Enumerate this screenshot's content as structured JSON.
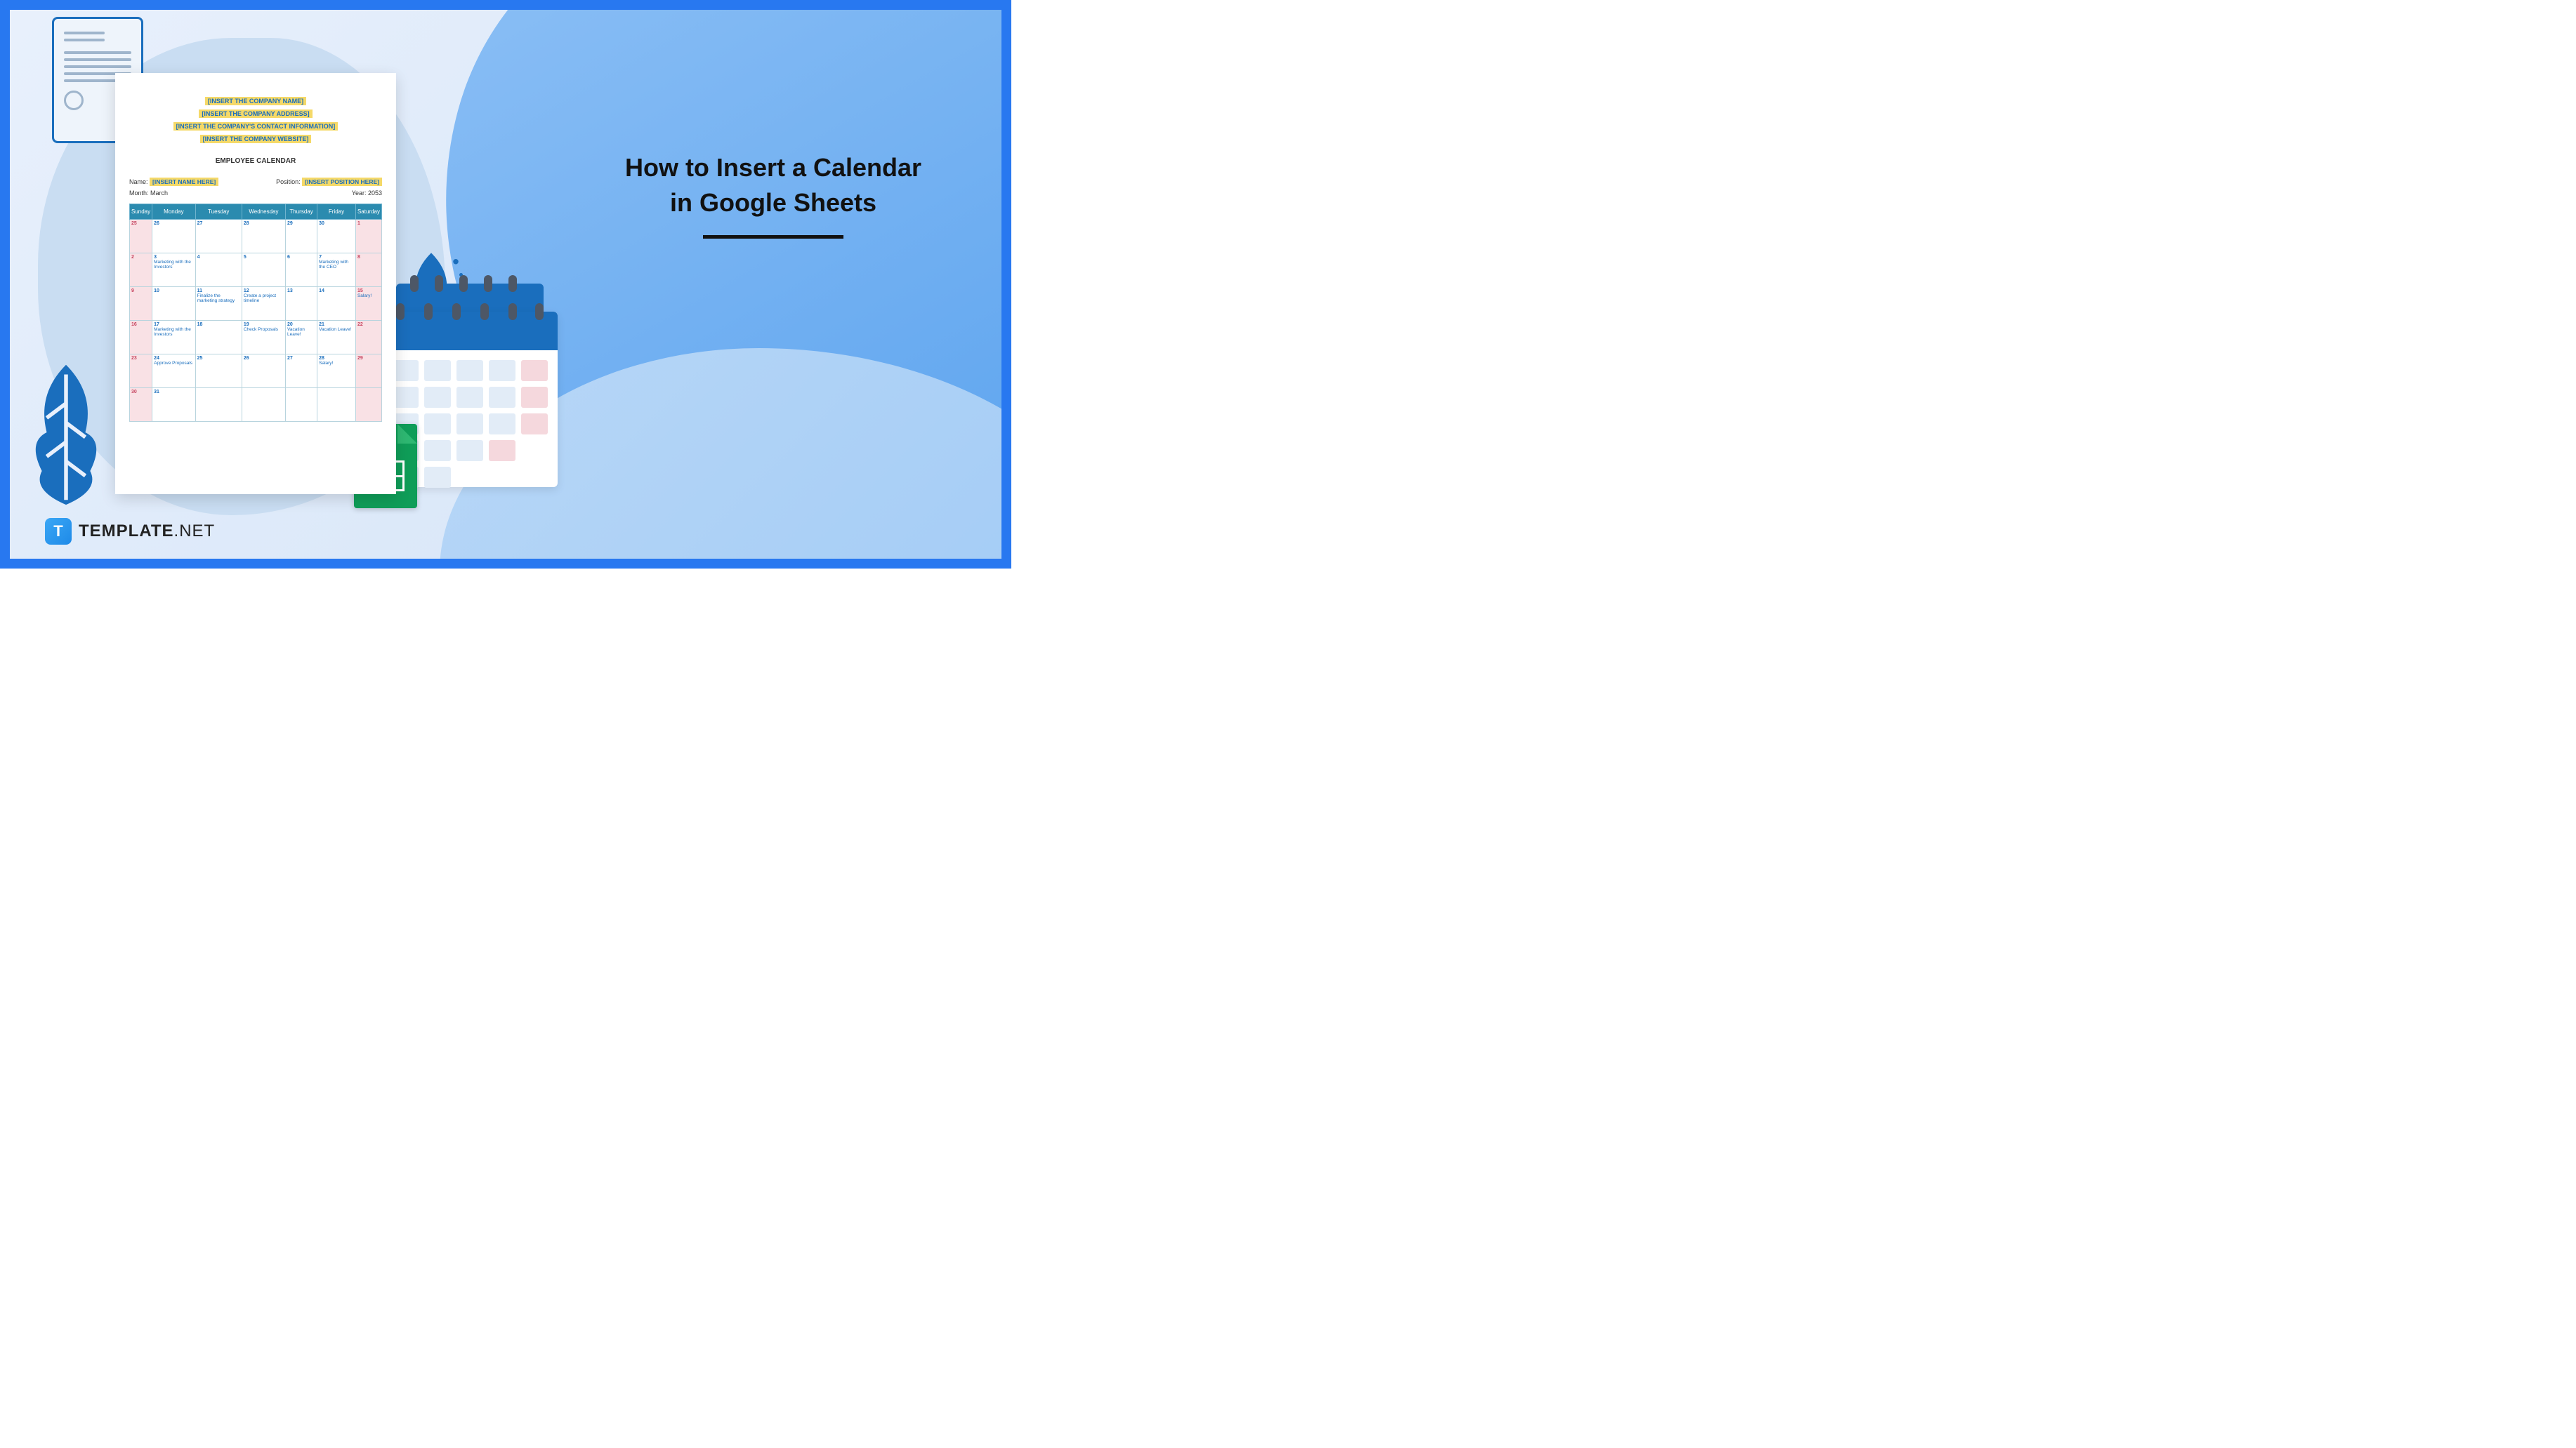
{
  "title": {
    "line1": "How to Insert a Calendar",
    "line2": "in Google Sheets"
  },
  "brand": {
    "icon_letter": "T",
    "name": "TEMPLATE",
    "suffix": ".NET"
  },
  "sheet": {
    "header_lines": [
      "[INSERT THE COMPANY NAME]",
      "[INSERT THE COMPANY ADDRESS]",
      "[INSERT THE COMPANY'S CONTACT INFORMATION]",
      "[INSERT THE COMPANY WEBSITE]"
    ],
    "calendar_title": "EMPLOYEE CALENDAR",
    "name_label": "Name:",
    "name_value": "[INSERT NAME HERE]",
    "position_label": "Position:",
    "position_value": "[INSERT POSITION HERE]",
    "month_label": "Month:",
    "month_value": "March",
    "year_label": "Year:",
    "year_value": "2053",
    "days": [
      "Sunday",
      "Monday",
      "Tuesday",
      "Wednesday",
      "Thursday",
      "Friday",
      "Saturday"
    ],
    "rows": [
      [
        {
          "n": "25",
          "wk": true
        },
        {
          "n": "26"
        },
        {
          "n": "27"
        },
        {
          "n": "28"
        },
        {
          "n": "29"
        },
        {
          "n": "30"
        },
        {
          "n": "1",
          "wk": true
        }
      ],
      [
        {
          "n": "2",
          "wk": true
        },
        {
          "n": "3",
          "t": "Marketing with the Investors"
        },
        {
          "n": "4"
        },
        {
          "n": "5"
        },
        {
          "n": "6"
        },
        {
          "n": "7",
          "t": "Marketing with the CEO"
        },
        {
          "n": "8",
          "wk": true
        }
      ],
      [
        {
          "n": "9",
          "wk": true
        },
        {
          "n": "10"
        },
        {
          "n": "11",
          "t": "Finalize the marketing strategy"
        },
        {
          "n": "12",
          "t": "Create a project timeline"
        },
        {
          "n": "13"
        },
        {
          "n": "14"
        },
        {
          "n": "15",
          "wk": true,
          "t": "Salary!"
        }
      ],
      [
        {
          "n": "16",
          "wk": true
        },
        {
          "n": "17",
          "t": "Marketing with the Investors"
        },
        {
          "n": "18"
        },
        {
          "n": "19",
          "t": "Check Proposals"
        },
        {
          "n": "20",
          "t": "Vacation Leave!"
        },
        {
          "n": "21",
          "t": "Vacation Leave!"
        },
        {
          "n": "22",
          "wk": true
        }
      ],
      [
        {
          "n": "23",
          "wk": true
        },
        {
          "n": "24",
          "t": "Approve Proposals"
        },
        {
          "n": "25"
        },
        {
          "n": "26"
        },
        {
          "n": "27"
        },
        {
          "n": "28",
          "t": "Salary!"
        },
        {
          "n": "29",
          "wk": true
        }
      ],
      [
        {
          "n": "30",
          "wk": true
        },
        {
          "n": "31"
        },
        {
          "n": ""
        },
        {
          "n": ""
        },
        {
          "n": ""
        },
        {
          "n": ""
        },
        {
          "n": "",
          "wk": true
        }
      ]
    ]
  }
}
